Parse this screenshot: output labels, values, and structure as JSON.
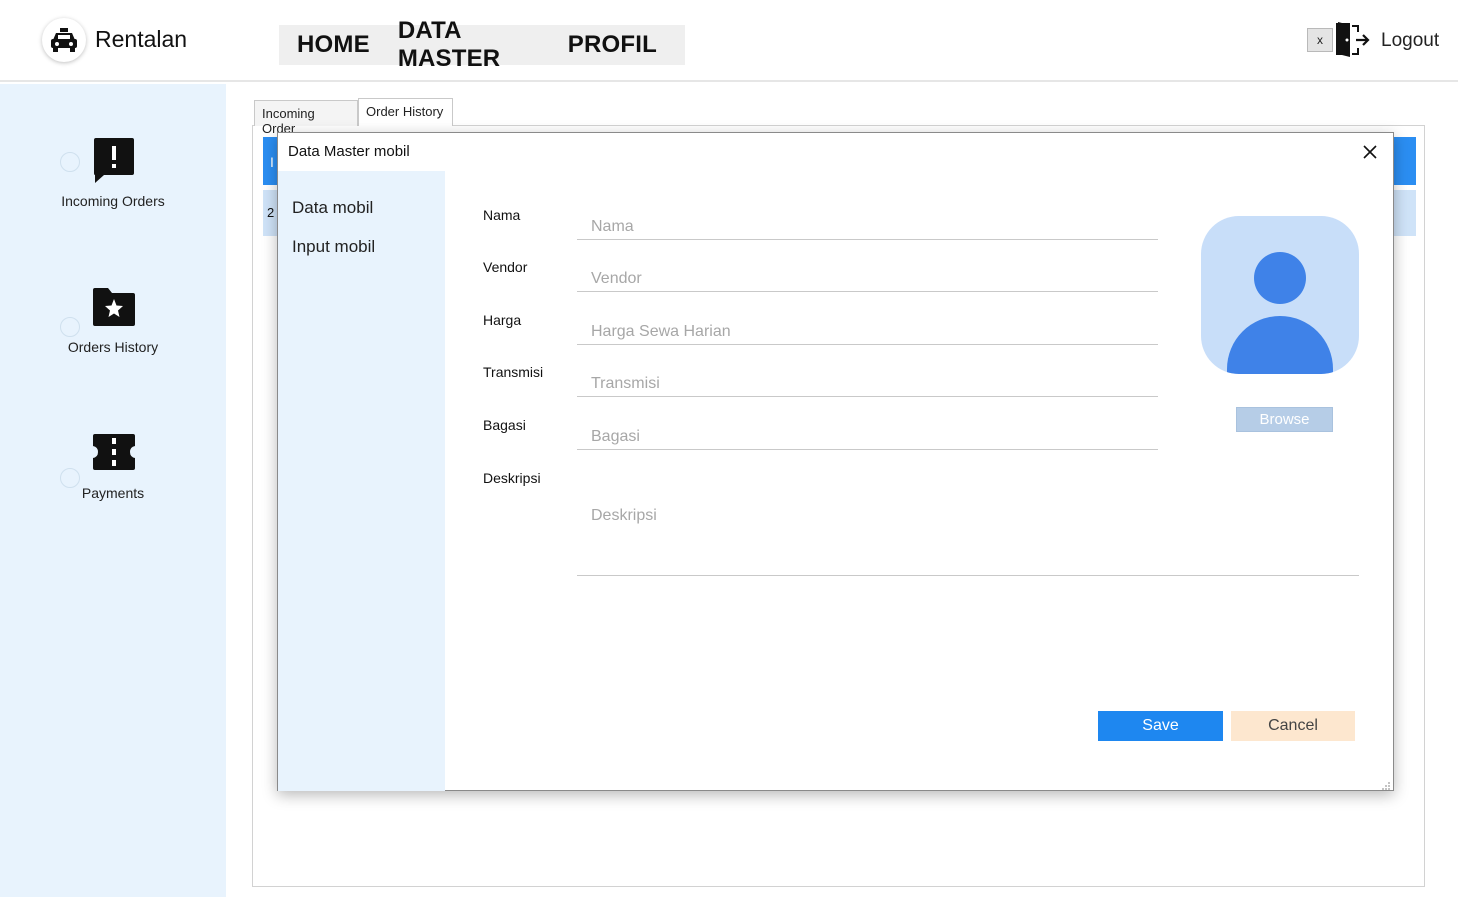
{
  "app": {
    "name": "Rentalan",
    "logo_icon": "car-icon"
  },
  "nav": {
    "items": [
      {
        "label": "HOME"
      },
      {
        "label": "DATA MASTER"
      },
      {
        "label": "PROFIL"
      }
    ]
  },
  "window_controls": {
    "close_label": "x"
  },
  "logout": {
    "label": "Logout",
    "icon": "logout-door-icon"
  },
  "sidebar": {
    "items": [
      {
        "label": "Incoming Orders",
        "icon": "alert-message-icon"
      },
      {
        "label": "Orders History",
        "icon": "star-folder-icon"
      },
      {
        "label": "Payments",
        "icon": "ticket-icon"
      }
    ]
  },
  "tabs": [
    {
      "label": "Incoming Order"
    },
    {
      "label": "Order History",
      "active": true
    }
  ],
  "background_table": {
    "header_char": "I",
    "row_char": "2"
  },
  "dialog": {
    "title": "Data Master mobil",
    "menu": [
      {
        "label": "Data mobil"
      },
      {
        "label": "Input mobil"
      }
    ],
    "fields": [
      {
        "label": "Nama",
        "placeholder": "Nama",
        "value": ""
      },
      {
        "label": "Vendor",
        "placeholder": "Vendor",
        "value": ""
      },
      {
        "label": "Harga",
        "placeholder": "Harga Sewa Harian",
        "value": ""
      },
      {
        "label": "Transmisi",
        "placeholder": "Transmisi",
        "value": ""
      },
      {
        "label": "Bagasi",
        "placeholder": "Bagasi",
        "value": ""
      }
    ],
    "description": {
      "label": "Deskripsi",
      "placeholder": "Deskripsi",
      "value": ""
    },
    "browse_label": "Browse",
    "save_label": "Save",
    "cancel_label": "Cancel"
  },
  "colors": {
    "accent": "#1e87f0",
    "sidebar_bg": "#e8f3fd",
    "cancel_bg": "#fde7cf",
    "avatar_bg": "#c8def9",
    "avatar_fg": "#3f82e8"
  }
}
